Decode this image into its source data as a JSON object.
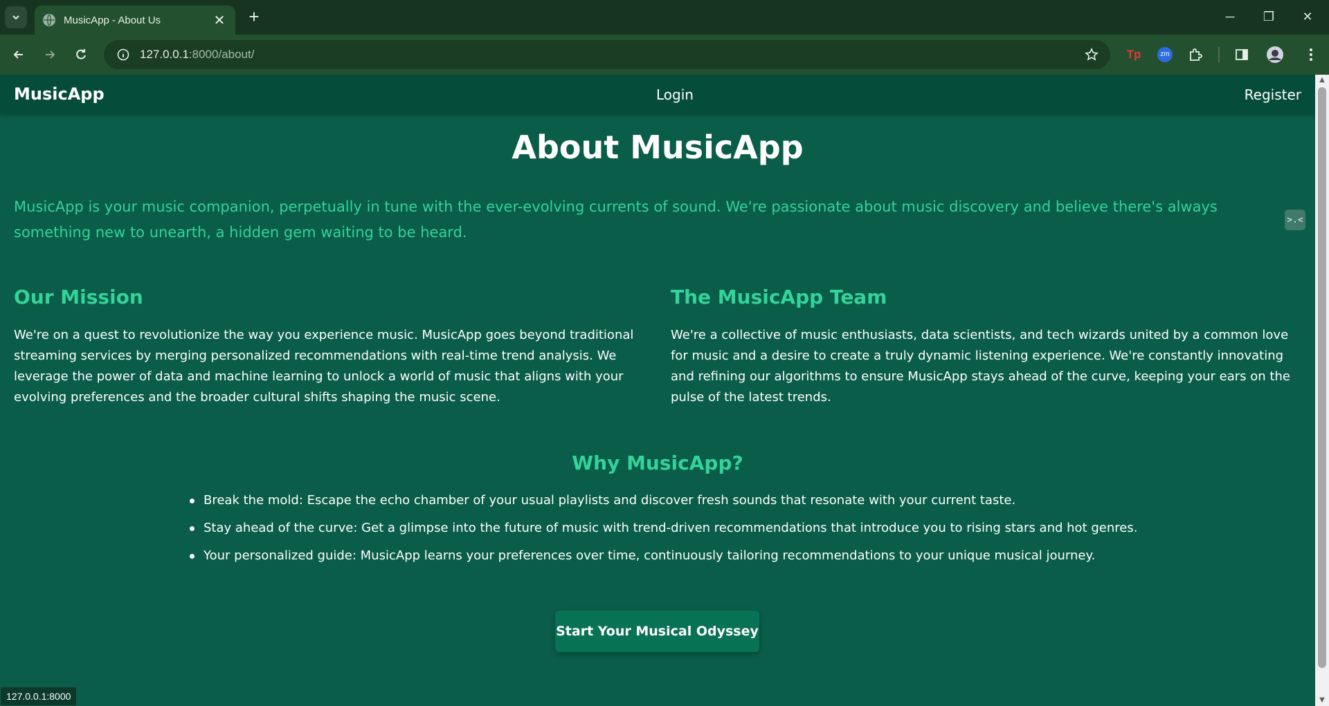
{
  "browser": {
    "tab_title": "MusicApp - About Us",
    "tab_close": "✕",
    "new_tab": "+",
    "url_host": "127.0.0.1",
    "url_path": ":8000/about/",
    "win_min": "─",
    "win_restore": "❐",
    "win_close": "✕",
    "ext_tp_label": "Tp",
    "ext_zm_label": "zm"
  },
  "nav": {
    "brand": "MusicApp",
    "login": "Login",
    "register": "Register"
  },
  "main": {
    "title": "About MusicApp",
    "intro": "MusicApp is your music companion, perpetually in tune with the ever-evolving currents of sound. We're passionate about music discovery and believe there's always something new to unearth, a hidden gem waiting to be heard.",
    "mission_heading": "Our Mission",
    "mission_text": "We're on a quest to revolutionize the way you experience music. MusicApp goes beyond traditional streaming services by merging personalized recommendations with real-time trend analysis. We leverage the power of data and machine learning to unlock a world of music that aligns with your evolving preferences and the broader cultural shifts shaping the music scene.",
    "team_heading": "The MusicApp Team",
    "team_text": "We're a collective of music enthusiasts, data scientists, and tech wizards united by a common love for music and a desire to create a truly dynamic listening experience. We're constantly innovating and refining our algorithms to ensure MusicApp stays ahead of the curve, keeping your ears on the pulse of the latest trends.",
    "why_heading": "Why MusicApp?",
    "why_items": [
      "Break the mold: Escape the echo chamber of your usual playlists and discover fresh sounds that resonate with your current taste.",
      "Stay ahead of the curve: Get a glimpse into the future of music with trend-driven recommendations that introduce you to rising stars and hot genres.",
      "Your personalized guide: MusicApp learns your preferences over time, continuously tailoring recommendations to your unique musical journey."
    ],
    "cta": "Start Your Musical Odyssey",
    "feedback_glyph": ">.<"
  },
  "status": {
    "link_preview": "127.0.0.1:8000"
  },
  "colors": {
    "page_bg": "#0a5d48",
    "navbar_bg": "#064c3a",
    "accent": "#34d399",
    "button_bg": "#087254"
  }
}
